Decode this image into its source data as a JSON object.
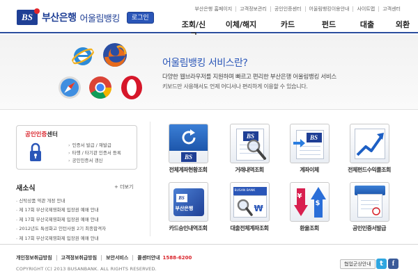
{
  "header": {
    "logo_mark": "BS",
    "bank_name": "부산은행",
    "service_name": "어울림뱅킹",
    "login_label": "로그인",
    "util_links": [
      "부산은행 홈페이지",
      "고객정보관리",
      "공인인증센터",
      "어울림뱅킹이용안내",
      "사이트맵",
      "고객센터"
    ],
    "gnb": [
      "조회/신고",
      "이체/해지",
      "카드",
      "펀드",
      "대출",
      "외환"
    ]
  },
  "hero": {
    "title": "어울림뱅킹 서비스란?",
    "desc1": "다양한 웹브라우저를 지원하며 빠르고 편리한 부산은행 어울림뱅킹 서비스",
    "desc2": "키보드만 사용해서도 언제 어디서나 편리하게 이용할 수 있습니다.",
    "browser_icons": [
      "internet-explorer-icon",
      "firefox-icon",
      "safari-icon",
      "chrome-icon",
      "opera-icon"
    ]
  },
  "cert": {
    "title_red": "공인인증",
    "title_rest": "센터",
    "items": [
      "인증서 발급 / 재발급",
      "타행 / 타기관 인증서 등록",
      "공인인증서 갱신"
    ]
  },
  "news": {
    "title": "새소식",
    "more": "+ 더보기",
    "items": [
      "신탁상품 약관 개정 안내",
      "제 17회 부산국제영화제 입장권 예매 안내",
      "제 17회 부산국제영화제 입장권 예매 안내",
      "2012년도 특성화고 인턴사원 2기 최종합격자",
      "제 17회 부산국제영화제 입장권 예매 안내"
    ]
  },
  "services": [
    {
      "label": "전체계좌현황조회",
      "icon": "refresh-icon"
    },
    {
      "label": "거래내역조회",
      "icon": "magnifier-icon"
    },
    {
      "label": "계좌이체",
      "icon": "transfer-icon"
    },
    {
      "label": "전체펀드수익률조회",
      "icon": "rising-chart-icon"
    },
    {
      "label": "카드승인내역조회",
      "icon": "card-icon"
    },
    {
      "label": "대출전체계좌조회",
      "icon": "loan-search-icon"
    },
    {
      "label": "환율조회",
      "icon": "exchange-icon"
    },
    {
      "label": "공인인증서발급",
      "icon": "certificate-icon"
    }
  ],
  "tile_text": {
    "bs": "BS",
    "card_brand": "부산은행",
    "busan_bank_en": "BUSAN BANK",
    "won": "₩",
    "yen": "¥",
    "dollar": "$"
  },
  "footer": {
    "links": [
      "개인정보취급방침",
      "고객정보취급방침",
      "보안서비스"
    ],
    "call_center_label": "콜센터안내",
    "phone": "1588-6200",
    "copyright": "COPYRIGHT (C) 2013 BUSANBANK. ALL RIGHTS RESERVED.",
    "affiliate_label": "협업군상안내",
    "twitter": "t",
    "facebook": "f"
  },
  "colors": {
    "brand_blue": "#1f3f95",
    "accent_blue": "#2a56b8",
    "accent_red": "#d9232a"
  }
}
